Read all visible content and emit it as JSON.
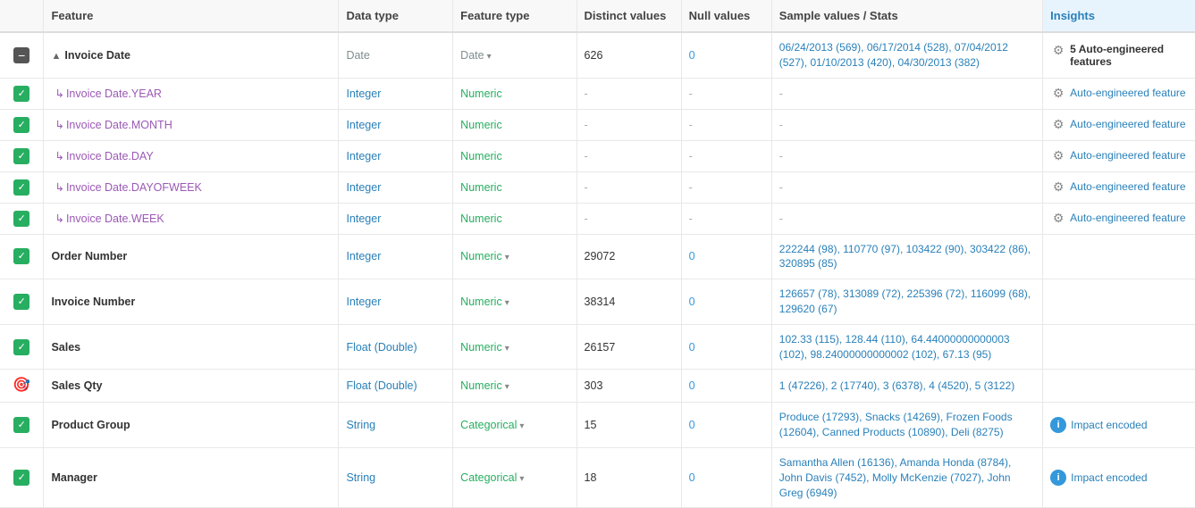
{
  "table": {
    "headers": {
      "check": "",
      "feature": "Feature",
      "datatype": "Data type",
      "featuretype": "Feature type",
      "distinct": "Distinct values",
      "null": "Null values",
      "sample": "Sample values / Stats",
      "insights": "Insights"
    },
    "rows": [
      {
        "id": "invoice-date",
        "check_type": "minus",
        "feature_label": "Invoice Date",
        "feature_prefix": "▲",
        "is_sub": false,
        "data_type": "Date",
        "feature_type": "Date",
        "feature_type_class": "ftype-date",
        "has_dropdown": true,
        "distinct": "626",
        "null_val": "0",
        "null_class": "null-zero",
        "sample": "06/24/2013 (569), 06/17/2014 (528), 07/04/2012 (527), 01/10/2013 (420), 04/30/2013 (382)",
        "insights_type": "auto-count",
        "insights_count": "5 Auto-engineered",
        "insights_label": "features"
      },
      {
        "id": "invoice-date-year",
        "check_type": "green",
        "feature_label": "Invoice Date.YEAR",
        "is_sub": true,
        "data_type": "Integer",
        "data_type_class": "type-integer",
        "feature_type": "Numeric",
        "feature_type_class": "ftype-numeric",
        "has_dropdown": false,
        "distinct": "-",
        "null_val": "-",
        "null_class": "null-dash",
        "sample": "-",
        "insights_type": "auto-link",
        "insights_label": "Auto-engineered feature"
      },
      {
        "id": "invoice-date-month",
        "check_type": "green",
        "feature_label": "Invoice Date.MONTH",
        "is_sub": true,
        "data_type": "Integer",
        "data_type_class": "type-integer",
        "feature_type": "Numeric",
        "feature_type_class": "ftype-numeric",
        "has_dropdown": false,
        "distinct": "-",
        "null_val": "-",
        "null_class": "null-dash",
        "sample": "-",
        "insights_type": "auto-link",
        "insights_label": "Auto-engineered feature"
      },
      {
        "id": "invoice-date-day",
        "check_type": "green",
        "feature_label": "Invoice Date.DAY",
        "is_sub": true,
        "data_type": "Integer",
        "data_type_class": "type-integer",
        "feature_type": "Numeric",
        "feature_type_class": "ftype-numeric",
        "has_dropdown": false,
        "distinct": "-",
        "null_val": "-",
        "null_class": "null-dash",
        "sample": "-",
        "insights_type": "auto-link",
        "insights_label": "Auto-engineered feature"
      },
      {
        "id": "invoice-date-dayofweek",
        "check_type": "green",
        "feature_label": "Invoice Date.DAYOFWEEK",
        "is_sub": true,
        "data_type": "Integer",
        "data_type_class": "type-integer",
        "feature_type": "Numeric",
        "feature_type_class": "ftype-numeric",
        "has_dropdown": false,
        "distinct": "-",
        "null_val": "-",
        "null_class": "null-dash",
        "sample": "-",
        "insights_type": "auto-link",
        "insights_label": "Auto-engineered feature"
      },
      {
        "id": "invoice-date-week",
        "check_type": "green",
        "feature_label": "Invoice Date.WEEK",
        "is_sub": true,
        "data_type": "Integer",
        "data_type_class": "type-integer",
        "feature_type": "Numeric",
        "feature_type_class": "ftype-numeric",
        "has_dropdown": false,
        "distinct": "-",
        "null_val": "-",
        "null_class": "null-dash",
        "sample": "-",
        "insights_type": "auto-link",
        "insights_label": "Auto-engineered feature"
      },
      {
        "id": "order-number",
        "check_type": "green",
        "feature_label": "Order Number",
        "is_sub": false,
        "data_type": "Integer",
        "data_type_class": "type-integer",
        "feature_type": "Numeric",
        "feature_type_class": "ftype-numeric",
        "has_dropdown": true,
        "distinct": "29072",
        "null_val": "0",
        "null_class": "null-zero",
        "sample": "222244 (98), 110770 (97), 103422 (90), 303422 (86), 320895 (85)",
        "insights_type": "none"
      },
      {
        "id": "invoice-number",
        "check_type": "green",
        "feature_label": "Invoice Number",
        "is_sub": false,
        "data_type": "Integer",
        "data_type_class": "type-integer",
        "feature_type": "Numeric",
        "feature_type_class": "ftype-numeric",
        "has_dropdown": true,
        "distinct": "38314",
        "null_val": "0",
        "null_class": "null-zero",
        "sample": "126657 (78), 313089 (72), 225396 (72), 116099 (68), 129620 (67)",
        "insights_type": "none"
      },
      {
        "id": "sales",
        "check_type": "green",
        "feature_label": "Sales",
        "is_sub": false,
        "data_type": "Float (Double)",
        "data_type_class": "type-float",
        "feature_type": "Numeric",
        "feature_type_class": "ftype-numeric",
        "has_dropdown": true,
        "distinct": "26157",
        "null_val": "0",
        "null_class": "null-zero",
        "sample": "102.33 (115), 128.44 (110), 64.44000000000003 (102), 98.24000000000002 (102), 67.13 (95)",
        "insights_type": "none"
      },
      {
        "id": "sales-qty",
        "check_type": "target",
        "feature_label": "Sales Qty",
        "is_sub": false,
        "data_type": "Float (Double)",
        "data_type_class": "type-float",
        "feature_type": "Numeric",
        "feature_type_class": "ftype-numeric",
        "has_dropdown": true,
        "distinct": "303",
        "null_val": "0",
        "null_class": "null-zero",
        "sample": "1 (47226), 2 (17740), 3 (6378), 4 (4520), 5 (3122)",
        "insights_type": "none"
      },
      {
        "id": "product-group",
        "check_type": "green",
        "feature_label": "Product Group",
        "is_sub": false,
        "data_type": "String",
        "data_type_class": "type-string",
        "feature_type": "Categorical",
        "feature_type_class": "ftype-categorical",
        "has_dropdown": true,
        "distinct": "15",
        "null_val": "0",
        "null_class": "null-zero",
        "sample": "Produce (17293), Snacks (14269), Frozen Foods (12604), Canned Products (10890), Deli (8275)",
        "insights_type": "impact",
        "insights_label": "Impact encoded"
      },
      {
        "id": "manager",
        "check_type": "green",
        "feature_label": "Manager",
        "is_sub": false,
        "data_type": "String",
        "data_type_class": "type-string",
        "feature_type": "Categorical",
        "feature_type_class": "ftype-categorical",
        "has_dropdown": true,
        "distinct": "18",
        "null_val": "0",
        "null_class": "null-zero",
        "sample": "Samantha Allen (16136), Amanda Honda (8784), John Davis (7452), Molly McKenzie (7027), John Greg (6949)",
        "insights_type": "impact",
        "insights_label": "Impact encoded"
      }
    ]
  }
}
